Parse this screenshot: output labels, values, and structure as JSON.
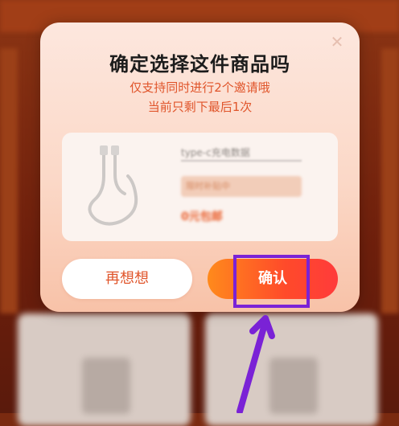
{
  "dialog": {
    "title": "确定选择这件商品吗",
    "subtitle_line1": "仅支持同时进行2个邀请哦",
    "subtitle_line2": "当前只剩下最后1次",
    "close_icon": "close-icon",
    "product": {
      "name": "type-c充电数据",
      "tag": "限时补贴中",
      "price": "0元包邮",
      "image_icon": "cable-icon"
    },
    "cancel_label": "再想想",
    "confirm_label": "确认"
  },
  "annotation": {
    "color": "#7a22d6"
  },
  "colors": {
    "accent_orange": "#e0552b",
    "confirm_gradient_start": "#ff8a1c",
    "confirm_gradient_end": "#ff3b3b"
  }
}
